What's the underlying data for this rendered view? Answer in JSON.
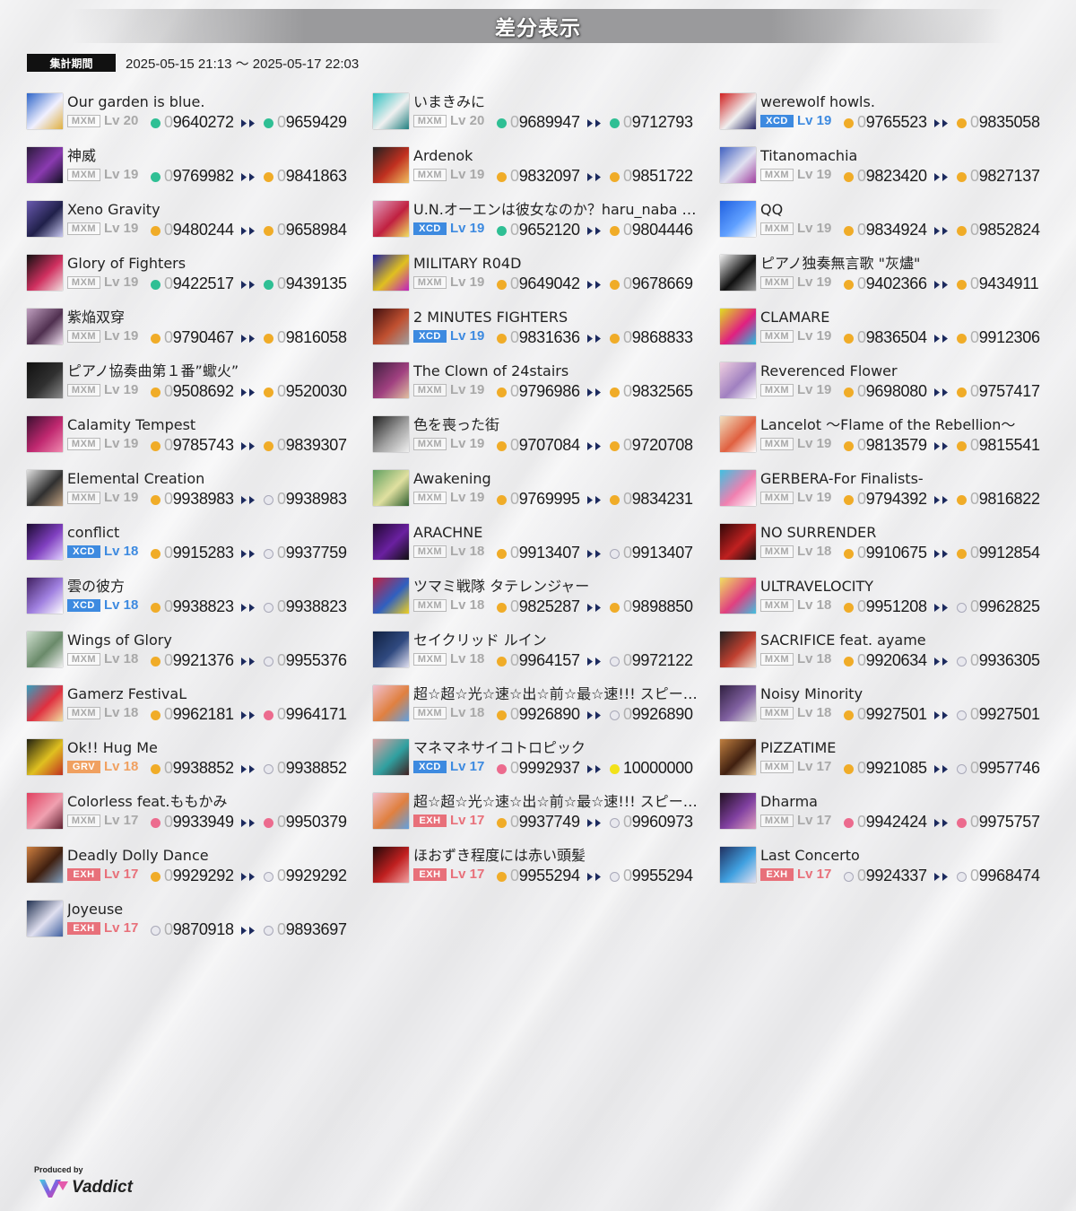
{
  "header": {
    "title": "差分表示"
  },
  "period": {
    "label": "集計期間",
    "range": "2025-05-15 21:13 〜 2025-05-17 22:03"
  },
  "colors": {
    "dot_teal": "#2fbf94",
    "dot_gold": "#f0ac28",
    "dot_white": "#e8e8ee",
    "dot_pink": "#ec6b8e",
    "dot_yellow": "#f2e21a",
    "arrow": "#1c2a5e",
    "MXM": "#a8a8a8",
    "XCD": "#3d8ae0",
    "EXH": "#e8707a",
    "GRV": "#f0a060"
  },
  "entries": [
    {
      "title": "Our garden is blue.",
      "diff": "MXM",
      "level": "Lv 20",
      "before_lamp": "teal",
      "before": "09640272",
      "after_lamp": "teal",
      "after": "09659429",
      "jacket": [
        "#2d64c8",
        "#f0f0ff",
        "#e0b040"
      ]
    },
    {
      "title": "神威",
      "diff": "MXM",
      "level": "Lv 19",
      "before_lamp": "teal",
      "before": "09769982",
      "after_lamp": "gold",
      "after": "09841863",
      "jacket": [
        "#2a1a3a",
        "#8a3ab0",
        "#101020"
      ]
    },
    {
      "title": "Xeno Gravity",
      "diff": "MXM",
      "level": "Lv 19",
      "before_lamp": "gold",
      "before": "09480244",
      "after_lamp": "gold",
      "after": "09658984",
      "jacket": [
        "#6a5ab0",
        "#20204a",
        "#c8c8f0"
      ]
    },
    {
      "title": "Glory of Fighters",
      "diff": "MXM",
      "level": "Lv 19",
      "before_lamp": "teal",
      "before": "09422517",
      "after_lamp": "teal",
      "after": "09439135",
      "jacket": [
        "#101010",
        "#d03060",
        "#f0e0e0"
      ]
    },
    {
      "title": "紫焔双穿",
      "diff": "MXM",
      "level": "Lv 19",
      "before_lamp": "gold",
      "before": "09790467",
      "after_lamp": "gold",
      "after": "09816058",
      "jacket": [
        "#c0a0c0",
        "#503050",
        "#f0e0f0"
      ]
    },
    {
      "title": "ピアノ協奏曲第１番”蠍火”",
      "diff": "MXM",
      "level": "Lv 19",
      "before_lamp": "gold",
      "before": "09508692",
      "after_lamp": "gold",
      "after": "09520030",
      "jacket": [
        "#101010",
        "#303030",
        "#8a8a8a"
      ]
    },
    {
      "title": "Calamity Tempest",
      "diff": "MXM",
      "level": "Lv 19",
      "before_lamp": "gold",
      "before": "09785743",
      "after_lamp": "gold",
      "after": "09839307",
      "jacket": [
        "#3a1030",
        "#c02870",
        "#f08ab0"
      ]
    },
    {
      "title": "Elemental Creation",
      "diff": "MXM",
      "level": "Lv 19",
      "before_lamp": "gold",
      "before": "09938983",
      "after_lamp": "white",
      "after": "09938983",
      "jacket": [
        "#e0e0e0",
        "#303030",
        "#c0a080"
      ]
    },
    {
      "title": "conflict",
      "diff": "XCD",
      "level": "Lv 18",
      "before_lamp": "gold",
      "before": "09915283",
      "after_lamp": "white",
      "after": "09937759",
      "jacket": [
        "#1a0a30",
        "#8040c0",
        "#e0d0ff"
      ]
    },
    {
      "title": "雲の彼方",
      "diff": "XCD",
      "level": "Lv 18",
      "before_lamp": "gold",
      "before": "09938823",
      "after_lamp": "white",
      "after": "09938823",
      "jacket": [
        "#402060",
        "#a080e0",
        "#ffffff"
      ]
    },
    {
      "title": "Wings of Glory",
      "diff": "MXM",
      "level": "Lv 18",
      "before_lamp": "gold",
      "before": "09921376",
      "after_lamp": "white",
      "after": "09955376",
      "jacket": [
        "#d0e0d0",
        "#6a8a6a",
        "#f0f0f0"
      ]
    },
    {
      "title": "Gamerz FestivaL",
      "diff": "MXM",
      "level": "Lv 18",
      "before_lamp": "gold",
      "before": "09962181",
      "after_lamp": "pink",
      "after": "09964171",
      "jacket": [
        "#30a0c0",
        "#e03040",
        "#f0e0a0"
      ]
    },
    {
      "title": "Ok!! Hug Me",
      "diff": "GRV",
      "level": "Lv 18",
      "before_lamp": "gold",
      "before": "09938852",
      "after_lamp": "white",
      "after": "09938852",
      "jacket": [
        "#202010",
        "#e0c020",
        "#c03020"
      ]
    },
    {
      "title": "Colorless feat.ももかみ",
      "diff": "MXM",
      "level": "Lv 17",
      "before_lamp": "pink",
      "before": "09933949",
      "after_lamp": "pink",
      "after": "09950379",
      "jacket": [
        "#e04060",
        "#f0a0b0",
        "#602030"
      ]
    },
    {
      "title": "Deadly Dolly Dance",
      "diff": "EXH",
      "level": "Lv 17",
      "before_lamp": "gold",
      "before": "09929292",
      "after_lamp": "white",
      "after": "09929292",
      "jacket": [
        "#d08040",
        "#402010",
        "#80a0c0"
      ]
    },
    {
      "title": "Joyeuse",
      "diff": "EXH",
      "level": "Lv 17",
      "before_lamp": "white",
      "before": "09870918",
      "after_lamp": "white",
      "after": "09893697",
      "jacket": [
        "#203050",
        "#e0e0f0",
        "#4060a0"
      ]
    },
    {
      "title": "いまきみに",
      "diff": "MXM",
      "level": "Lv 20",
      "before_lamp": "teal",
      "before": "09689947",
      "after_lamp": "teal",
      "after": "09712793",
      "jacket": [
        "#30c0c0",
        "#f0f0f0",
        "#208080"
      ]
    },
    {
      "title": "Ardenok",
      "diff": "MXM",
      "level": "Lv 19",
      "before_lamp": "gold",
      "before": "09832097",
      "after_lamp": "gold",
      "after": "09851722",
      "jacket": [
        "#202020",
        "#c03020",
        "#f0c060"
      ]
    },
    {
      "title": "U.N.オーエンは彼女なのか？haru_naba remix",
      "diff": "XCD",
      "level": "Lv 19",
      "before_lamp": "teal",
      "before": "09652120",
      "after_lamp": "gold",
      "after": "09804446",
      "jacket": [
        "#e0a0c0",
        "#c02040",
        "#f0e060"
      ]
    },
    {
      "title": "MILITARY R04D",
      "diff": "MXM",
      "level": "Lv 19",
      "before_lamp": "gold",
      "before": "09649042",
      "after_lamp": "gold",
      "after": "09678669",
      "jacket": [
        "#2020a0",
        "#e0c020",
        "#c020c0"
      ]
    },
    {
      "title": "2 MINUTES FIGHTERS",
      "diff": "XCD",
      "level": "Lv 19",
      "before_lamp": "gold",
      "before": "09831636",
      "after_lamp": "gold",
      "after": "09868833",
      "jacket": [
        "#401010",
        "#c05030",
        "#a0a0a0"
      ]
    },
    {
      "title": "The Clown of 24stairs",
      "diff": "MXM",
      "level": "Lv 19",
      "before_lamp": "gold",
      "before": "09796986",
      "after_lamp": "gold",
      "after": "09832565",
      "jacket": [
        "#402040",
        "#a04080",
        "#e0c0a0"
      ]
    },
    {
      "title": "色を喪った街",
      "diff": "MXM",
      "level": "Lv 19",
      "before_lamp": "gold",
      "before": "09707084",
      "after_lamp": "gold",
      "after": "09720708",
      "jacket": [
        "#202020",
        "#a0a0a0",
        "#f0f0f0"
      ]
    },
    {
      "title": "Awakening",
      "diff": "MXM",
      "level": "Lv 19",
      "before_lamp": "gold",
      "before": "09769995",
      "after_lamp": "gold",
      "after": "09834231",
      "jacket": [
        "#60a060",
        "#e0e0a0",
        "#306030"
      ]
    },
    {
      "title": "ARACHNE",
      "diff": "MXM",
      "level": "Lv 18",
      "before_lamp": "gold",
      "before": "09913407",
      "after_lamp": "white",
      "after": "09913407",
      "jacket": [
        "#200830",
        "#6a20a0",
        "#101010"
      ]
    },
    {
      "title": "ツマミ戦隊 タテレンジャー",
      "diff": "MXM",
      "level": "Lv 18",
      "before_lamp": "gold",
      "before": "09825287",
      "after_lamp": "gold",
      "after": "09898850",
      "jacket": [
        "#c02040",
        "#3060c0",
        "#f0d020"
      ]
    },
    {
      "title": "セイクリッド ルイン",
      "diff": "MXM",
      "level": "Lv 18",
      "before_lamp": "gold",
      "before": "09964157",
      "after_lamp": "white",
      "after": "09972122",
      "jacket": [
        "#102040",
        "#304a80",
        "#e0e0f0"
      ]
    },
    {
      "title": "超☆超☆光☆速☆出☆前☆最☆速!!! スピード★デリバリー",
      "diff": "MXM",
      "level": "Lv 18",
      "before_lamp": "gold",
      "before": "09926890",
      "after_lamp": "white",
      "after": "09926890",
      "jacket": [
        "#f0c0d0",
        "#e08040",
        "#60a0e0"
      ]
    },
    {
      "title": "マネマネサイコトロピック",
      "diff": "XCD",
      "level": "Lv 17",
      "before_lamp": "pink",
      "before": "09992937",
      "after_lamp": "yellow",
      "after": "10000000",
      "jacket": [
        "#e0a0a0",
        "#30a0a0",
        "#402020"
      ]
    },
    {
      "title": "超☆超☆光☆速☆出☆前☆最☆速!!! スピード★デリバリー",
      "diff": "EXH",
      "level": "Lv 17",
      "before_lamp": "gold",
      "before": "09937749",
      "after_lamp": "white",
      "after": "09960973",
      "jacket": [
        "#f0c0d0",
        "#e08040",
        "#60a0e0"
      ]
    },
    {
      "title": "ほおずき程度には赤い頭髪",
      "diff": "EXH",
      "level": "Lv 17",
      "before_lamp": "gold",
      "before": "09955294",
      "after_lamp": "white",
      "after": "09955294",
      "jacket": [
        "#200808",
        "#c02020",
        "#f0a0a0"
      ]
    },
    {
      "title": "werewolf howls.",
      "diff": "XCD",
      "level": "Lv 19",
      "before_lamp": "gold",
      "before": "09765523",
      "after_lamp": "gold",
      "after": "09835058",
      "jacket": [
        "#d02020",
        "#f0f0f0",
        "#202060"
      ]
    },
    {
      "title": "Titanomachia",
      "diff": "MXM",
      "level": "Lv 19",
      "before_lamp": "gold",
      "before": "09823420",
      "after_lamp": "gold",
      "after": "09827137",
      "jacket": [
        "#4060c0",
        "#e0e0f0",
        "#a040a0"
      ]
    },
    {
      "title": "QQ",
      "diff": "MXM",
      "level": "Lv 19",
      "before_lamp": "gold",
      "before": "09834924",
      "after_lamp": "gold",
      "after": "09852824",
      "jacket": [
        "#2060e0",
        "#60a0ff",
        "#ffffff"
      ]
    },
    {
      "title": "ピアノ独奏無言歌 \"灰燼\"",
      "diff": "MXM",
      "level": "Lv 19",
      "before_lamp": "gold",
      "before": "09402366",
      "after_lamp": "gold",
      "after": "09434911",
      "jacket": [
        "#f0f0f0",
        "#101010",
        "#a0a0a0"
      ]
    },
    {
      "title": "CLAMARE",
      "diff": "MXM",
      "level": "Lv 19",
      "before_lamp": "gold",
      "before": "09836504",
      "after_lamp": "gold",
      "after": "09912306",
      "jacket": [
        "#e0e020",
        "#e02080",
        "#20c0e0"
      ]
    },
    {
      "title": "Reverenced Flower",
      "diff": "MXM",
      "level": "Lv 19",
      "before_lamp": "gold",
      "before": "09698080",
      "after_lamp": "gold",
      "after": "09757417",
      "jacket": [
        "#f0d0e0",
        "#a080c0",
        "#ffffff"
      ]
    },
    {
      "title": "Lancelot 〜Flame of the Rebellion〜",
      "diff": "MXM",
      "level": "Lv 19",
      "before_lamp": "gold",
      "before": "09813579",
      "after_lamp": "gold",
      "after": "09815541",
      "jacket": [
        "#f0e0c0",
        "#e06040",
        "#ffffff"
      ]
    },
    {
      "title": "GERBERA-For Finalists-",
      "diff": "MXM",
      "level": "Lv 19",
      "before_lamp": "gold",
      "before": "09794392",
      "after_lamp": "gold",
      "after": "09816822",
      "jacket": [
        "#40c0e0",
        "#f080b0",
        "#ffffff"
      ]
    },
    {
      "title": "NO SURRENDER",
      "diff": "MXM",
      "level": "Lv 18",
      "before_lamp": "gold",
      "before": "09910675",
      "after_lamp": "gold",
      "after": "09912854",
      "jacket": [
        "#300808",
        "#c02020",
        "#101010"
      ]
    },
    {
      "title": "ULTRAVELOCITY",
      "diff": "MXM",
      "level": "Lv 18",
      "before_lamp": "gold",
      "before": "09951208",
      "after_lamp": "white",
      "after": "09962825",
      "jacket": [
        "#f0e060",
        "#e04080",
        "#40c0e0"
      ]
    },
    {
      "title": "SACRIFICE feat. ayame",
      "diff": "MXM",
      "level": "Lv 18",
      "before_lamp": "gold",
      "before": "09920634",
      "after_lamp": "white",
      "after": "09936305",
      "jacket": [
        "#202020",
        "#c04030",
        "#f0e0d0"
      ]
    },
    {
      "title": "Noisy Minority",
      "diff": "MXM",
      "level": "Lv 18",
      "before_lamp": "gold",
      "before": "09927501",
      "after_lamp": "white",
      "after": "09927501",
      "jacket": [
        "#302040",
        "#8060a0",
        "#e0e0e0"
      ]
    },
    {
      "title": "PIZZATIME",
      "diff": "MXM",
      "level": "Lv 17",
      "before_lamp": "gold",
      "before": "09921085",
      "after_lamp": "white",
      "after": "09957746",
      "jacket": [
        "#c08040",
        "#402010",
        "#f0d0a0"
      ]
    },
    {
      "title": "Dharma",
      "diff": "MXM",
      "level": "Lv 17",
      "before_lamp": "pink",
      "before": "09942424",
      "after_lamp": "pink",
      "after": "09975757",
      "jacket": [
        "#201020",
        "#8040a0",
        "#e0a0c0"
      ]
    },
    {
      "title": "Last Concerto",
      "diff": "EXH",
      "level": "Lv 17",
      "before_lamp": "white",
      "before": "09924337",
      "after_lamp": "white",
      "after": "09968474",
      "jacket": [
        "#203060",
        "#40a0e0",
        "#e0e0f0"
      ]
    }
  ],
  "footer": {
    "produced": "Produced by",
    "brand": "Vaddict"
  }
}
